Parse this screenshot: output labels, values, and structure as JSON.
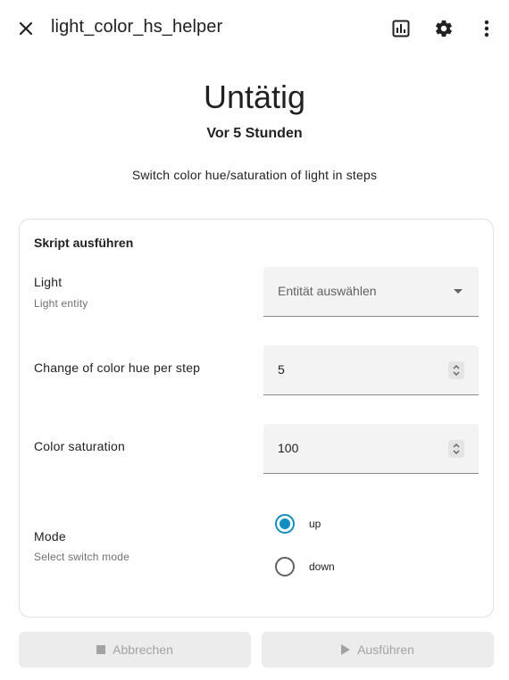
{
  "header": {
    "title": "light_color_hs_helper",
    "close_icon": "close-icon",
    "history_icon": "chart-box-icon",
    "settings_icon": "gear-icon",
    "menu_icon": "dots-vertical-icon"
  },
  "status": {
    "state": "Untätig",
    "last_changed": "Vor 5 Stunden",
    "description": "Switch color hue/saturation of light in steps"
  },
  "card": {
    "title": "Skript ausführen",
    "fields": {
      "light": {
        "label": "Light",
        "sublabel": "Light entity",
        "placeholder": "Entität auswählen"
      },
      "hue_step": {
        "label": "Change of color hue per step",
        "value": "5"
      },
      "saturation": {
        "label": "Color saturation",
        "value": "100"
      },
      "mode": {
        "label": "Mode",
        "sublabel": "Select switch mode",
        "options": [
          "up",
          "down"
        ],
        "selected": "up"
      }
    }
  },
  "actions": {
    "cancel_label": "Abbrechen",
    "run_label": "Ausführen"
  },
  "colors": {
    "accent": "#0f8fbf",
    "disabled_bg": "#ececec",
    "disabled_text": "#a3a3a3"
  }
}
